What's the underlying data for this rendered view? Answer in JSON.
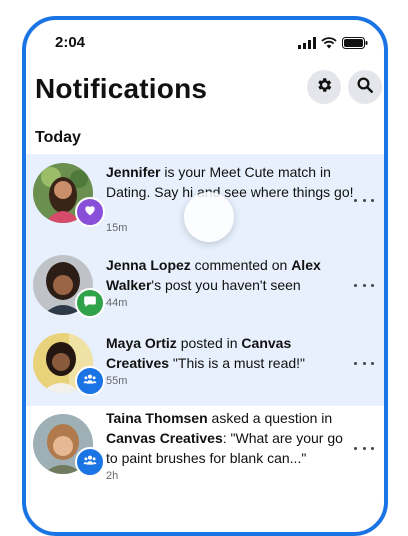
{
  "status_bar": {
    "time": "2:04"
  },
  "header": {
    "title": "Notifications"
  },
  "section": {
    "label": "Today"
  },
  "notifications": [
    {
      "actor": "Jennifer",
      "text": " is your Meet Cute match in Dating. Say hi and see where things go!",
      "time": "15m",
      "badge": "heart-icon",
      "badge_color": "#8a4fd8"
    },
    {
      "actor": "Jenna Lopez",
      "text": " commented on ",
      "target": "Alex Walker",
      "text2": "'s post you haven't seen",
      "time": "44m",
      "badge": "comment-icon",
      "badge_color": "#30a24a"
    },
    {
      "actor": "Maya Ortiz",
      "text": " posted in ",
      "target": "Canvas Creatives",
      "text2": " \"This is a must read!\"",
      "time": "55m",
      "badge": "group-icon",
      "badge_color": "#1b74e4"
    },
    {
      "actor": "Taina Thomsen",
      "text": " asked a question in ",
      "target": "Canvas Creatives",
      "text2": ": \"What are your go to paint brushes for blank can...\"",
      "time": "2h",
      "badge": "group-icon",
      "badge_color": "#1b74e4"
    }
  ],
  "colors": {
    "accent": "#1b74e4",
    "unread_bg": "#e7f0fc"
  }
}
